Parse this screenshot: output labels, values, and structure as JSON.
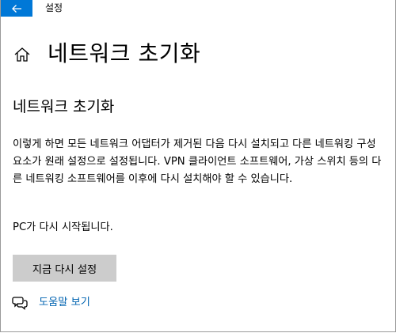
{
  "window": {
    "title": "설정"
  },
  "header": {
    "back_icon": "back-arrow-icon",
    "home_icon": "home-icon",
    "page_title": "네트워크 초기화"
  },
  "main": {
    "section_title": "네트워크 초기화",
    "description": "이렇게 하면 모든 네트워크 어댑터가 제거된 다음 다시 설치되고 다른 네트워킹 구성 요소가 원래 설정으로 설정됩니다. VPN 클라이언트 소프트웨어, 가상 스위치 등의 다른 네트워킹 소프트웨어를 이후에 다시 설치해야 할 수 있습니다.",
    "restart_note": "PC가 다시 시작됩니다.",
    "reset_button_label": "지금 다시 설정",
    "help_link_label": "도움말 보기",
    "help_icon": "chat-bubbles-icon"
  },
  "colors": {
    "accent": "#0078d7",
    "link": "#0063b1",
    "button_bg": "#cccccc"
  }
}
